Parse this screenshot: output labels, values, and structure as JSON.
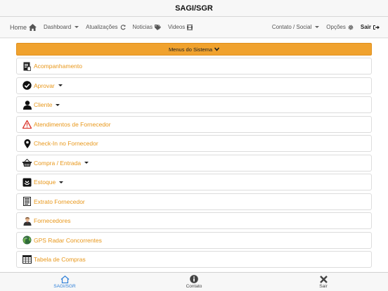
{
  "window": {
    "title": "SAGI/SGR"
  },
  "nav": {
    "home": "Home",
    "dashboard": "Dashboard",
    "atualizacoes": "Atualizações",
    "noticias": "Noticias",
    "videos": "Videos",
    "contato_social": "Contato / Social",
    "opcoes": "Opções",
    "sair": "Sair"
  },
  "menu": {
    "header": "Menus do Sistema",
    "items": [
      {
        "label": "Acompanhamento",
        "icon": "document-icon",
        "dropdown": false
      },
      {
        "label": "Aprovar",
        "icon": "check-circle-icon",
        "dropdown": true
      },
      {
        "label": "Cliente",
        "icon": "person-icon",
        "dropdown": true
      },
      {
        "label": "Atendimentos de Fornecedor",
        "icon": "warning-icon",
        "dropdown": false
      },
      {
        "label": "Check-In no Fornecedor",
        "icon": "map-pin-icon",
        "dropdown": false
      },
      {
        "label": "Compra / Entrada",
        "icon": "shopping-basket-icon",
        "dropdown": true
      },
      {
        "label": "Estoque",
        "icon": "inbox-icon",
        "dropdown": true
      },
      {
        "label": "Extrato Fornecedor",
        "icon": "statement-icon",
        "dropdown": false
      },
      {
        "label": "Fornecedores",
        "icon": "supplier-person-icon",
        "dropdown": false
      },
      {
        "label": "GPS Radar Concorrentes",
        "icon": "globe-icon",
        "dropdown": false
      },
      {
        "label": "Tabela de Compras",
        "icon": "table-icon",
        "dropdown": false
      }
    ]
  },
  "tabs": {
    "home": "SAGI/SGR",
    "contato": "Contato",
    "sair": "Sair"
  },
  "colors": {
    "accent": "#f0a22e",
    "menu_text": "#e8971a",
    "tab_active": "#2d7fd8"
  }
}
